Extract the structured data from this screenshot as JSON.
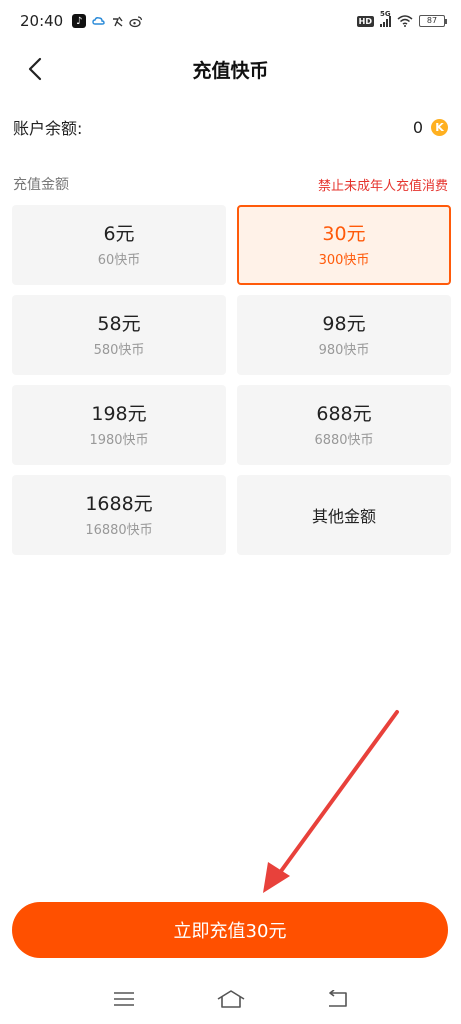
{
  "status_bar": {
    "time": "20:40",
    "network": "5G",
    "hd": "HD",
    "battery": "87",
    "apps": [
      "tiktok-icon",
      "cloud-app-icon",
      "app-icon",
      "weibo-icon"
    ]
  },
  "header": {
    "title": "充值快币",
    "back_icon": "chevron-left-icon"
  },
  "balance": {
    "label": "账户余额:",
    "value": "0",
    "coin_icon": "coin-icon",
    "coin_glyph": "K"
  },
  "section": {
    "label": "充值金额",
    "warning": "禁止未成年人充值消费"
  },
  "amounts": [
    {
      "price": "6元",
      "coins": "60快币",
      "selected": false
    },
    {
      "price": "30元",
      "coins": "300快币",
      "selected": true
    },
    {
      "price": "58元",
      "coins": "580快币",
      "selected": false
    },
    {
      "price": "98元",
      "coins": "980快币",
      "selected": false
    },
    {
      "price": "198元",
      "coins": "1980快币",
      "selected": false
    },
    {
      "price": "688元",
      "coins": "6880快币",
      "selected": false
    },
    {
      "price": "1688元",
      "coins": "16880快币",
      "selected": false
    }
  ],
  "other_amount": "其他金额",
  "recharge_button": "立即充值30元",
  "colors": {
    "accent": "#ff5000",
    "selected_bg": "#fff2e8",
    "warning": "#e5342e",
    "annotation_arrow": "#e8413b"
  },
  "nav_bar": {
    "menu_icon": "menu-icon",
    "home_icon": "home-icon",
    "back_icon": "back-icon"
  }
}
